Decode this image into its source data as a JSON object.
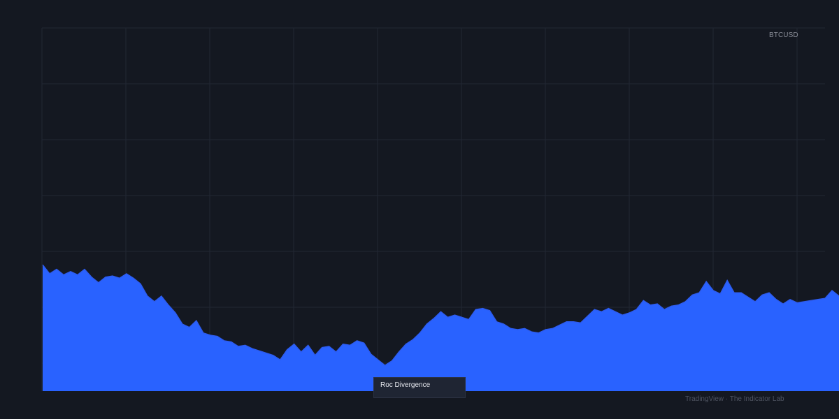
{
  "colors": {
    "background": "#141821",
    "grid": "#222734",
    "area_fill": "#2962ff",
    "area_line": "#2d5cf0",
    "label": "#8a8e98",
    "tooltip_bg": "#1f2533",
    "tooltip_text": "#e6e8ee",
    "watermark": "#4f5461"
  },
  "series_label": "BTCUSD",
  "tooltip_label": "Roc Divergence",
  "watermark": "TradingView · The Indicator Lab",
  "chart_data": {
    "type": "area",
    "series": [
      {
        "name": "BTCUSD",
        "x": [
          0,
          10,
          20,
          30,
          40,
          50,
          60,
          70,
          80,
          90,
          100,
          110,
          120,
          130,
          140,
          150,
          160,
          170,
          180,
          190,
          200,
          210,
          220,
          230,
          240,
          250,
          260,
          270,
          280,
          290,
          300,
          310,
          320,
          330,
          340,
          350,
          360,
          370,
          380,
          390,
          400,
          410,
          420,
          430,
          440,
          450,
          460,
          470,
          480,
          490,
          500,
          510,
          520,
          530,
          540,
          550,
          560,
          570,
          580,
          590,
          600,
          610,
          620,
          630,
          640,
          650,
          660,
          670,
          680,
          690,
          700,
          710,
          720,
          730,
          740,
          750,
          760,
          770,
          780,
          790,
          800,
          810,
          820,
          830,
          840,
          850,
          860,
          870,
          880,
          890,
          900,
          910,
          920,
          930,
          940,
          950,
          960,
          970,
          980,
          990,
          1000,
          1010,
          1020,
          1030,
          1040,
          1050,
          1060,
          1070,
          1080,
          1090,
          1100,
          1110,
          1120,
          1130,
          1140
        ],
        "values": [
          22.6,
          21.0,
          21.8,
          20.8,
          21.4,
          20.8,
          21.8,
          20.4,
          19.4,
          20.4,
          20.6,
          20.2,
          21.0,
          20.2,
          19.2,
          17.0,
          16.0,
          17.0,
          15.4,
          14.0,
          12.0,
          11.4,
          12.6,
          10.4,
          10.0,
          9.8,
          9.0,
          8.8,
          8.0,
          8.2,
          7.6,
          7.2,
          6.8,
          6.4,
          5.6,
          7.4,
          8.4,
          7.0,
          8.2,
          6.4,
          7.8,
          8.0,
          7.0,
          8.4,
          8.2,
          9.0,
          8.6,
          6.6,
          5.6,
          4.6,
          5.4,
          7.0,
          8.4,
          9.2,
          10.4,
          12.0,
          13.0,
          14.2,
          13.2,
          13.6,
          13.2,
          12.8,
          14.6,
          14.8,
          14.4,
          12.4,
          12.0,
          11.2,
          11.0,
          11.2,
          10.6,
          10.4,
          11.0,
          11.2,
          11.8,
          12.4,
          12.4,
          12.2,
          13.4,
          14.6,
          14.2,
          14.8,
          14.2,
          13.6,
          14.0,
          14.6,
          16.2,
          15.4,
          15.6,
          14.6,
          15.2,
          15.4,
          16.0,
          17.2,
          17.6,
          19.6,
          18.0,
          17.4,
          19.8,
          17.6,
          17.6,
          16.8,
          16.0,
          17.2,
          17.6,
          16.4,
          15.6,
          16.4,
          15.8,
          16.0,
          16.2,
          16.4,
          16.6,
          18.0,
          17.0
        ]
      }
    ],
    "xlim": [
      0,
      1140
    ],
    "ylim": [
      0,
      65
    ],
    "grid": true
  }
}
